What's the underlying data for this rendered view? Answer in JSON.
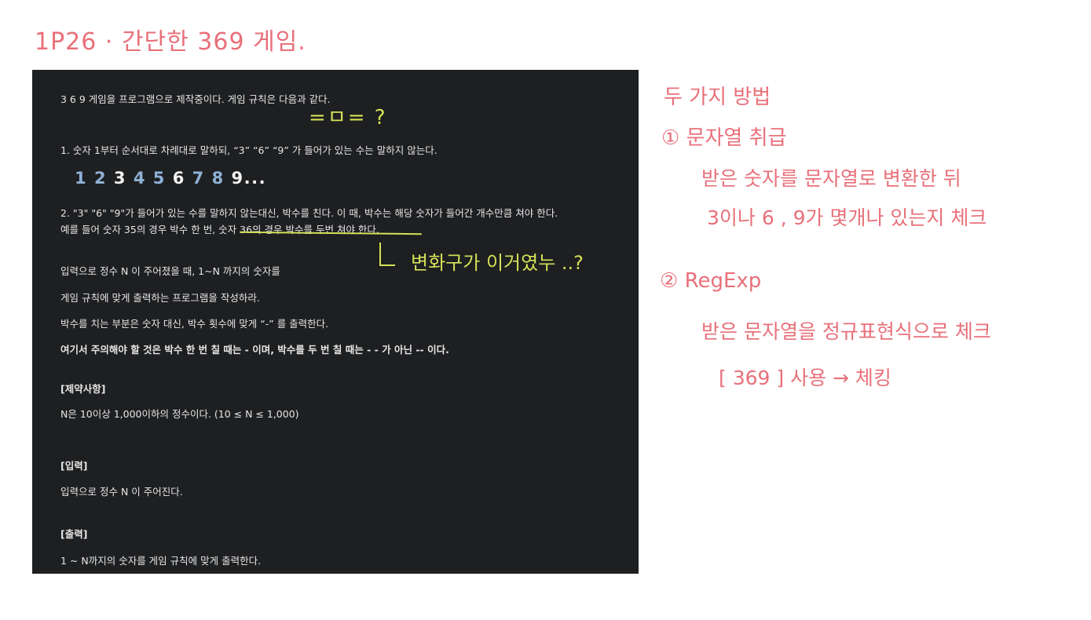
{
  "header": {
    "title": "1P26 · 간단한 369 게임."
  },
  "problem": {
    "intro": "3 6 9 게임을 프로그램으로 제작중이다. 게임 규칙은 다음과 같다.",
    "rule1": "1. 숫자 1부터 순서대로 차례대로 말하되, “3” “6” “9” 가 들어가 있는 수는 말하지 않는다.",
    "digits": [
      "1",
      "2",
      "3",
      "4",
      "5",
      "6",
      "7",
      "8",
      "9",
      "..."
    ],
    "rule2_line1": "2. \"3\" \"6\" \"9\"가 들어가 있는 수를 말하지 않는대신, 박수를 친다. 이 때, 박수는 해당 숫자가 들어간 개수만큼 쳐야 한다.",
    "rule2_line2": "예를 들어 숫자 35의 경우 박수 한 번, 숫자 36의 경우 박수를 두번 쳐야 한다.",
    "input_desc": "입력으로 정수 N 이 주어졌을 때, 1~N 까지의 숫자를",
    "output_desc": "게임 규칙에 맞게 출력하는 프로그램을 작성하라.",
    "clap_desc": "박수를 치는 부분은 숫자 대신, 박수 횟수에 맞게 “-” 를 출력한다.",
    "caution": "여기서 주의해야 할 것은 박수 한 번 칠 때는 - 이며, 박수를 두 번 칠 때는 - - 가 아닌 -- 이다.",
    "constraints_header": "[제약사항]",
    "constraints": "N은 10이상 1,000이하의 정수이다. (10 ≤ N ≤ 1,000)",
    "input_header": "[입력]",
    "input_text": "입력으로 정수 N 이 주어진다.",
    "output_header": "[출력]",
    "output_text": "1 ~ N까지의 숫자를 게임 규칙에 맞게 출력한다."
  },
  "annotations": {
    "question_mark": "=ㅁ= ?",
    "note": "변화구가 이거였누 ..?"
  },
  "notes": {
    "heading": "두 가지 방법",
    "method1_label": "① 문자열 취급",
    "method1_line1": "받은 숫자를 문자열로 변환한 뒤",
    "method1_line2": "3이나 6 , 9가 몇개나 있는지 체크",
    "method2_label": "② RegExp",
    "method2_line1": "받은 문자열을 정규표현식으로 체크",
    "method2_line2": "[ 369 ] 사용 → 체킹"
  },
  "colors": {
    "handwriting_pink": "#e8707a",
    "annotation_green": "#d4e157",
    "panel_bg": "#1e1f21",
    "digit_blue": "#8fb1d6"
  }
}
